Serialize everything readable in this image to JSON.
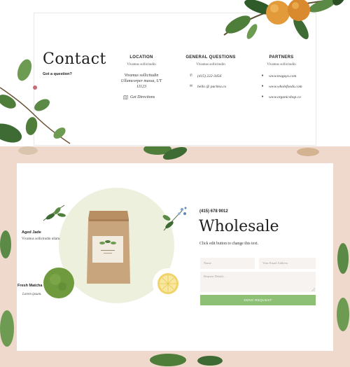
{
  "colors": {
    "peach_bg": "#efd9cc",
    "circle_green": "#eef0de",
    "button_green": "#8dbf75",
    "field_bg": "#f7f3f0"
  },
  "contact": {
    "title": "Contact",
    "subtitle": "Got a question?",
    "location": {
      "heading": "LOCATION",
      "subheading": "Vivamus sollicitudin",
      "address_line1": "Vivamus sollicitudin",
      "address_line2": "Ullamcorper massa, UT",
      "address_line3": "11123",
      "directions_label": "Get Directions",
      "directions_icon": "map-icon"
    },
    "general": {
      "heading": "GENERAL QUESTIONS",
      "subheading": "Vivamus sollicitudin",
      "phone": "(415) 222-3456",
      "phone_icon": "phone-icon",
      "email": "hello @ puritea.co",
      "email_icon": "envelope-icon"
    },
    "partners": {
      "heading": "PARTNERS",
      "subheading": "Vivamus sollicitudin",
      "links": [
        {
          "label": "www.teaguys.com",
          "icon": "location-pin-icon"
        },
        {
          "label": "www.wholefoods.com",
          "icon": "location-pin-icon"
        },
        {
          "label": "www.organicshop.co",
          "icon": "location-pin-icon"
        }
      ]
    }
  },
  "products": {
    "aged_jade": {
      "title": "Aged Jade",
      "desc": "Vivamus sollicitudin ullam."
    },
    "fresh_matcha": {
      "title": "Fresh Matcha",
      "desc": "Lorem ipsum."
    }
  },
  "wholesale": {
    "phone": "(415) 678 9012",
    "title": "Wholesale",
    "text": "Click edit button to change this text.",
    "form": {
      "name_placeholder": "Name",
      "email_placeholder": "Your Email Address",
      "details_placeholder": "Request Details...",
      "send_label": "SEND REQUEST"
    }
  }
}
